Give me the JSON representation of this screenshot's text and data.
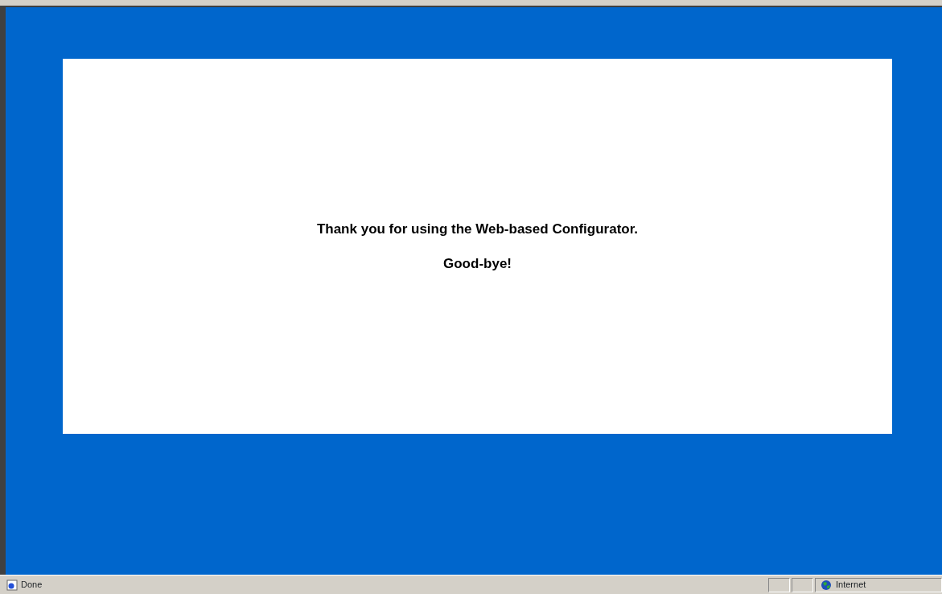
{
  "page": {
    "message": "Thank you for using the Web-based Configurator.",
    "farewell": "Good-bye!"
  },
  "status_bar": {
    "status": "Done",
    "zone": "Internet"
  }
}
